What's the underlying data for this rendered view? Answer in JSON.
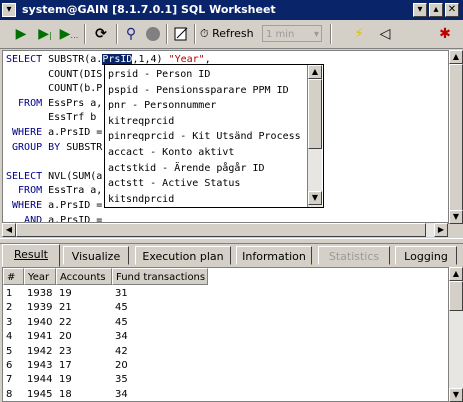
{
  "window": {
    "title": "system@GAIN [8.1.7.0.1] SQL Worksheet"
  },
  "toolbar": {
    "refresh_label": "Refresh",
    "refresh_interval": "1 min"
  },
  "editor": {
    "lines": [
      [
        "SELECT",
        " SUBSTR(a.",
        "PrsID",
        ",1,4) ",
        "\"Year\"",
        ","
      ],
      [
        "",
        "       COUNT(DIS",
        "",
        "",
        "",
        ""
      ],
      [
        "",
        "       COUNT(b.P",
        "",
        "",
        "",
        ""
      ],
      [
        "  FROM",
        " EssPrs a,",
        "",
        "",
        "",
        ""
      ],
      [
        "",
        "       EssTrf b",
        "",
        "",
        "",
        ""
      ],
      [
        " WHERE",
        " a.PrsID =",
        "",
        "",
        "",
        ""
      ],
      [
        " GROUP BY",
        " SUBSTR",
        "",
        "",
        "",
        ""
      ],
      [
        "",
        "",
        "",
        "",
        "",
        ""
      ],
      [
        "SELECT",
        " NVL(SUM(a",
        "",
        "",
        "",
        ""
      ],
      [
        "  FROM",
        " EssTra a,",
        "",
        "",
        "",
        ""
      ],
      [
        " WHERE",
        " a.PrsID =",
        "",
        "",
        "",
        ""
      ],
      [
        "   AND",
        " a.PrsID =",
        "",
        "",
        "",
        ""
      ]
    ]
  },
  "autocomplete": {
    "items": [
      "prsid - Person ID",
      "pspid - Pensionssparare PPM ID",
      "pnr - Personnummer",
      "kitreqprcid",
      "pinreqprcid - Kit Utsänd Process",
      "accact - Konto aktivt",
      "actstkid - Ärende pågår ID",
      "actstt - Active Status",
      "kitsndprcid"
    ]
  },
  "tabs": [
    {
      "label": "Result",
      "state": "active"
    },
    {
      "label": "Visualize",
      "state": "normal"
    },
    {
      "label": "Execution plan",
      "state": "normal"
    },
    {
      "label": "Information",
      "state": "normal"
    },
    {
      "label": "Statistics",
      "state": "disabled"
    },
    {
      "label": "Logging",
      "state": "normal"
    }
  ],
  "result": {
    "headers": [
      "#",
      "Year",
      "Accounts",
      "Fund transactions"
    ],
    "rows": [
      [
        "1",
        "1938",
        "19",
        "31"
      ],
      [
        "2",
        "1939",
        "21",
        "45"
      ],
      [
        "3",
        "1940",
        "22",
        "45"
      ],
      [
        "4",
        "1941",
        "20",
        "34"
      ],
      [
        "5",
        "1942",
        "23",
        "42"
      ],
      [
        "6",
        "1943",
        "17",
        "20"
      ],
      [
        "7",
        "1944",
        "19",
        "35"
      ],
      [
        "8",
        "1945",
        "18",
        "34"
      ]
    ]
  },
  "colors": {
    "titlebar": "#0a246a",
    "keyword": "#00008b",
    "string": "#b00000",
    "selection": "#0a246a"
  }
}
